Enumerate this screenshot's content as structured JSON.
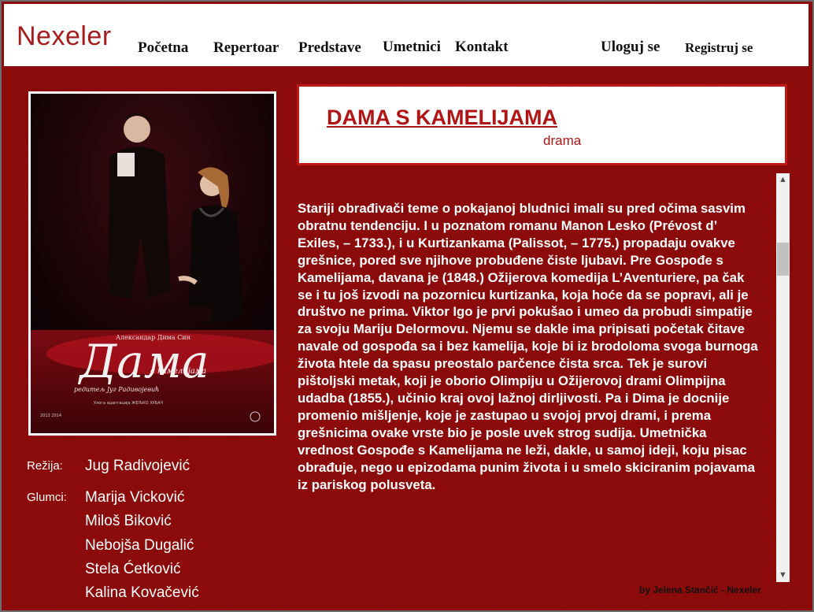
{
  "header": {
    "logo": "Nexeler",
    "nav": [
      "Početna",
      "Repertoar",
      "Predstave",
      "Umetnici",
      "Kontakt"
    ],
    "login": "Uloguj se",
    "register": "Registruj se"
  },
  "poster": {
    "title_script": "Дама",
    "subtitle_script": "с камелијама",
    "author": "Александар Дима Син",
    "director": "редитељ Југ Радивојевић",
    "footer": "Улога адаптација ЖЕЉКО ХУБАЧ",
    "year": "2013 2014"
  },
  "play": {
    "title": "DAMA S KAMELIJAMA",
    "genre": "drama",
    "description": "Stariji obrađivači teme o pokajanoj bludnici imali su pred očima sasvim obratnu tendenciju. I u poznatom romanu Manon Lesko (Prévost d’ Exiles, – 1733.), i u Kurtizankama (Palissot, – 1775.) propadaju ovakve grešnice, pored sve njihove probuđene čiste ljubavi. Pre Gospođe s Kamelijama, davana je (1848.) Ožijerova komedija L’Aventuriere, pa čak se i tu još izvodi na pozornicu kurtizanka, koja hoće da se popravi, ali je društvo ne prima. Viktor Igo je prvi pokušao i umeo da probudi simpatije za svoju Mariju Delormovu. Njemu se dakle ima pripisati početak čitave navale od gospođa sa i bez kamelija, koje bi iz brodoloma svoga burnoga života htele da spasu preostalo parčence čista srca. Tek je surovi pištoljski metak, koji je oborio Olimpiju u Ožijerovoj drami Olimpijna udadba (1855.), učinio kraj ovoj lažnoj dirljivosti. Pa i Dima je docnije promenio mišljenje, koje je zastupao u svojoj prvoj drami, i prema grešnicima ovake vrste bio je posle uvek strog sudija. Umetnička vrednost Gospođe s Kamelijama ne leži, dakle, u samoj ideji, koju pisac obrađuje, nego u epizodama punim života i u smelo skiciranim pojavama iz pariskog polusveta.",
    "direction_label": "Režija:",
    "director": "Jug Radivojević",
    "cast_label": "Glumci:",
    "cast": [
      "Marija Vicković",
      "Miloš Biković",
      "Nebojša Dugalić",
      "Stela Ćetković",
      "Kalina Kovačević"
    ]
  },
  "footer": {
    "credit": "by Jelena Stančić - Nexeler"
  },
  "colors": {
    "background": "#8e0b0b",
    "accent": "#b01414",
    "header": "#ffffff"
  },
  "icons": {
    "scroll_up": "chevron-up-icon",
    "scroll_down": "chevron-down-icon"
  }
}
